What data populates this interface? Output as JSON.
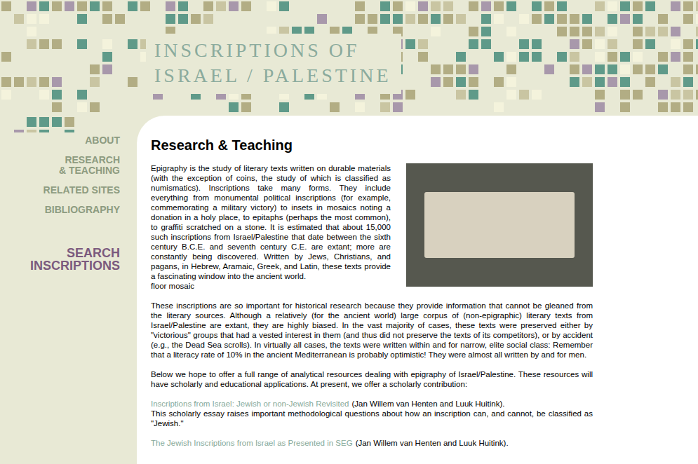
{
  "header": {
    "title_lines": [
      "INSCRIPTIONS OF",
      "ISRAEL / PALESTINE"
    ]
  },
  "nav": {
    "items": [
      {
        "lines": [
          "ABOUT"
        ]
      },
      {
        "lines": [
          "RESEARCH",
          "& TEACHING"
        ]
      },
      {
        "lines": [
          "RELATED SITES"
        ]
      },
      {
        "lines": [
          "BIBLIOGRAPHY"
        ]
      }
    ],
    "search_link": {
      "lines": [
        "SEARCH",
        "INSCRIPTIONS"
      ]
    }
  },
  "content": {
    "heading": "Research & Teaching",
    "intro": "Epigraphy is the study of literary texts written on durable materials (with the exception of coins, the study of which is classified as numismatics). Inscriptions take many forms. They include everything from monumental political inscriptions (for example, commemorating a military victory) to insets in mosaics noting a donation in a holy place, to epitaphs (perhaps the most common), to graffiti scratched on a stone. It is estimated that about 15,000 such inscriptions from Israel/Palestine that date between the sixth century B.C.E. and seventh century C.E. are extant; more are constantly being discovered. Written by Jews, Christians, and pagans, in Hebrew, Aramaic, Greek, and Latin, these texts provide a fascinating window into the ancient world.",
    "photo_caption": "floor mosaic",
    "paragraphs": [
      "These inscriptions are so important for historical research because they provide information that cannot be gleaned from the literary sources. Although a relatively (for the ancient world) large corpus of (non-epigraphic) literary texts from Israel/Palestine are extant, they are highly biased. In the vast majority of cases, these texts were preserved either by \"victorious\" groups that had a vested interest in them (and thus did not preserve the texts of its competitors), or by accident (e.g., the Dead Sea scrolls). In virtually all cases, the texts were written within and for narrow, elite social class: Remember that a literacy rate of 10% in the ancient Mediterranean is probably optimistic! They were almost all written by and for men.",
      "Below we hope to offer a full range of analytical resources dealing with epigraphy of Israel/Palestine. These resources will have scholarly and educational applications. At present, we offer a scholarly contribution:"
    ],
    "resources": [
      {
        "link": "Inscriptions from Israel: Jewish or non-Jewish Revisited",
        "authors": "(Jan Willem van Henten and Luuk Huitink).",
        "description": "This scholarly essay raises important methodological questions about how an inscription can, and cannot, be classified as \"Jewish.\""
      },
      {
        "link": "The Jewish Inscriptions from Israel as Presented in SEG",
        "authors": "(Jan Willem van Henten and Luuk Huitink).",
        "description": ""
      }
    ]
  }
}
